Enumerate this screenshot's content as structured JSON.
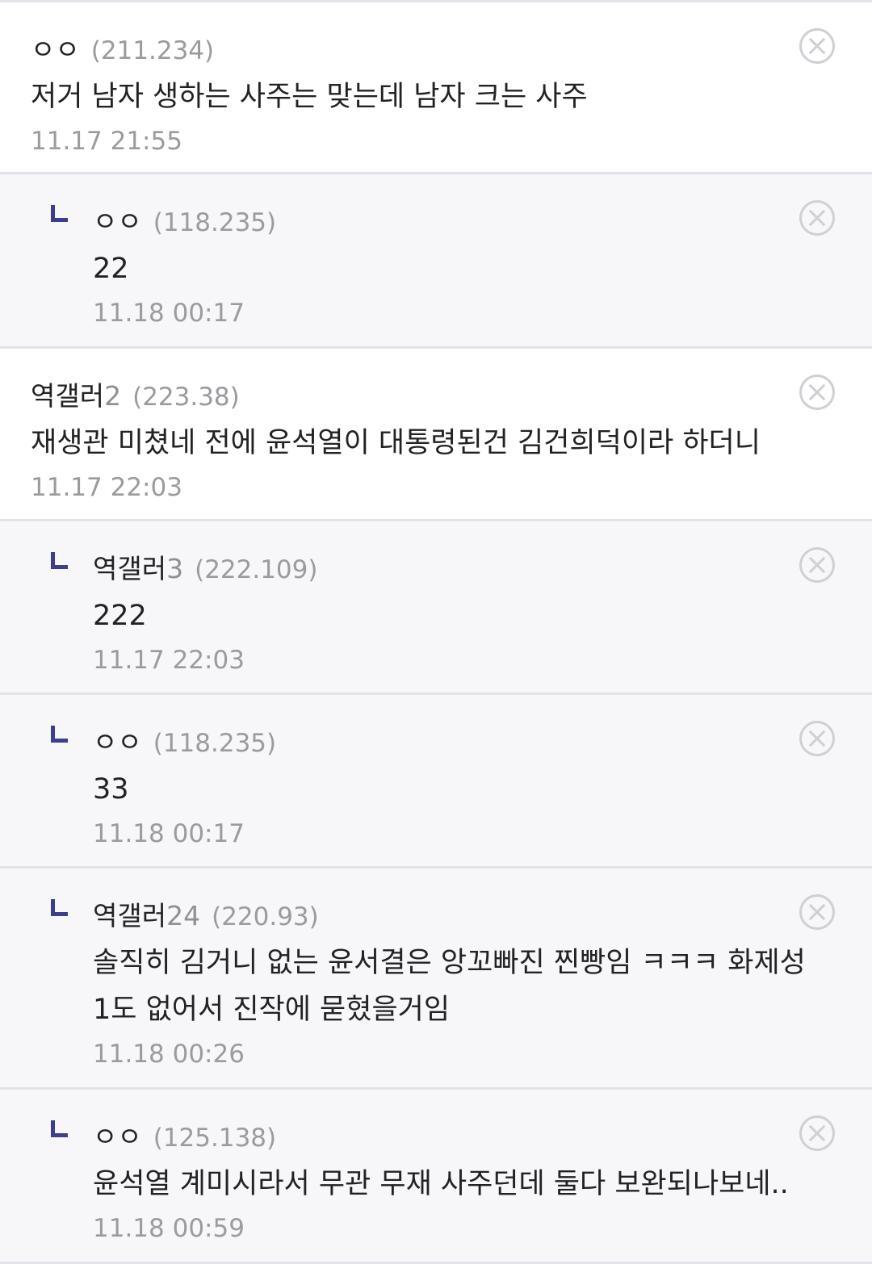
{
  "comments": [
    {
      "name": "ㅇㅇ",
      "name_num": "",
      "ip": "(211.234)",
      "text": "저거 남자 생하는 사주는 맞는데 남자 크는 사주",
      "date": "11.17 21:55"
    },
    {
      "name": "ㅇㅇ",
      "name_num": "",
      "ip": "(118.235)",
      "text": "22",
      "date": "11.18 00:17"
    },
    {
      "name": "역갤러",
      "name_num": "2",
      "ip": "(223.38)",
      "text": "재생관 미쳤네 전에 윤석열이 대통령된건 김건희덕이라 하더니",
      "date": "11.17 22:03"
    },
    {
      "name": "역갤러",
      "name_num": "3",
      "ip": "(222.109)",
      "text": "222",
      "date": "11.17 22:03"
    },
    {
      "name": "ㅇㅇ",
      "name_num": "",
      "ip": "(118.235)",
      "text": "33",
      "date": "11.18 00:17"
    },
    {
      "name": "역갤러",
      "name_num": "24",
      "ip": "(220.93)",
      "text": "솔직히 김거니 없는 윤서결은 앙꼬빠진 찐빵임 ㅋㅋㅋ 화제성\n1도 없어서 진작에 묻혔을거임",
      "date": "11.18 00:26"
    },
    {
      "name": "ㅇㅇ",
      "name_num": "",
      "ip": "(125.138)",
      "text": "윤석열 계미시라서 무관 무재 사주던데 둘다 보완되나보네..",
      "date": "11.18 00:59"
    }
  ]
}
